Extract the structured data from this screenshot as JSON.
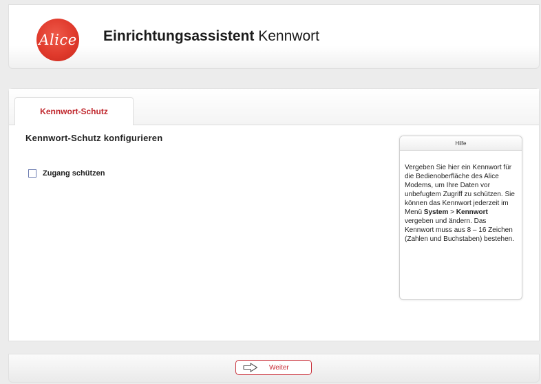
{
  "header": {
    "logo_text": "Alice",
    "title_bold": "Einrichtungsassistent",
    "title_rest": "Kennwort"
  },
  "tabs": [
    {
      "label": "Kennwort-Schutz",
      "active": true
    }
  ],
  "main": {
    "section_title": "Kennwort-Schutz konfigurieren",
    "checkbox": {
      "label": "Zugang schützen",
      "checked": false
    }
  },
  "help": {
    "title": "Hilfe",
    "text_before": "Vergeben Sie hier ein Kennwort für die Bedienoberfläche des Alice Modems, um Ihre Daten vor unbefugtem Zugriff zu schützen. Sie können das Kennwort jederzeit im Menü",
    "menu_path_1": "System",
    "menu_sep": ">",
    "menu_path_2": "Kennwort",
    "text_after": "vergeben und ändern. Das Kennwort muss aus 8 – 16 Zeichen (Zahlen und Buchstaben) bestehen."
  },
  "footer": {
    "next_label": "Weiter",
    "next_icon": "arrow-right-icon"
  },
  "colors": {
    "accent": "#c0272d",
    "logo": "#e03a2c",
    "checkbox_border": "#6b7bb0"
  }
}
